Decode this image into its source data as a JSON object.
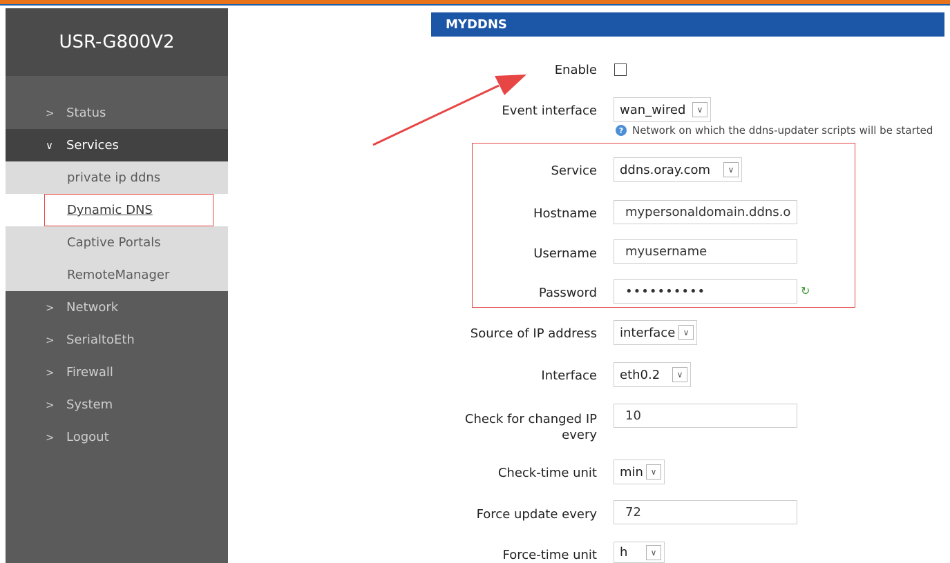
{
  "brand": {
    "title": "USR-G800V2"
  },
  "sidebar": {
    "items": [
      {
        "label": "Status",
        "chevron": ">"
      },
      {
        "label": "Services",
        "chevron": "∨"
      },
      {
        "label": "Network",
        "chevron": ">"
      },
      {
        "label": "SerialtoEth",
        "chevron": ">"
      },
      {
        "label": "Firewall",
        "chevron": ">"
      },
      {
        "label": "System",
        "chevron": ">"
      },
      {
        "label": "Logout",
        "chevron": ">"
      }
    ],
    "submenu": [
      {
        "label": "private ip ddns"
      },
      {
        "label": "Dynamic DNS"
      },
      {
        "label": "Captive Portals"
      },
      {
        "label": "RemoteManager"
      }
    ]
  },
  "main": {
    "section_title": "MYDDNS",
    "fields": {
      "enable": {
        "label": "Enable"
      },
      "event_interface": {
        "label": "Event interface",
        "value": "wan_wired",
        "hint": "Network on which the ddns-updater scripts will be started"
      },
      "service": {
        "label": "Service",
        "value": "ddns.oray.com"
      },
      "hostname": {
        "label": "Hostname",
        "value": "mypersonaldomain.ddns.o"
      },
      "username": {
        "label": "Username",
        "value": "myusername"
      },
      "password": {
        "label": "Password",
        "value": "••••••••••"
      },
      "source_ip": {
        "label": "Source of IP address",
        "value": "interface"
      },
      "interface": {
        "label": "Interface",
        "value": "eth0.2"
      },
      "check_interval": {
        "label_line1": "Check for changed IP",
        "label_line2": "every",
        "value": "10"
      },
      "check_unit": {
        "label": "Check-time unit",
        "value": "min"
      },
      "force_interval": {
        "label": "Force update every",
        "value": "72"
      },
      "force_unit": {
        "label": "Force-time unit",
        "value": "h"
      }
    }
  },
  "icons": {
    "caret": "∨",
    "help": "?",
    "refresh": "↻"
  },
  "colors": {
    "accent_orange": "#e8731a",
    "header_blue": "#1c56a7",
    "annotation_red": "#e84545"
  }
}
